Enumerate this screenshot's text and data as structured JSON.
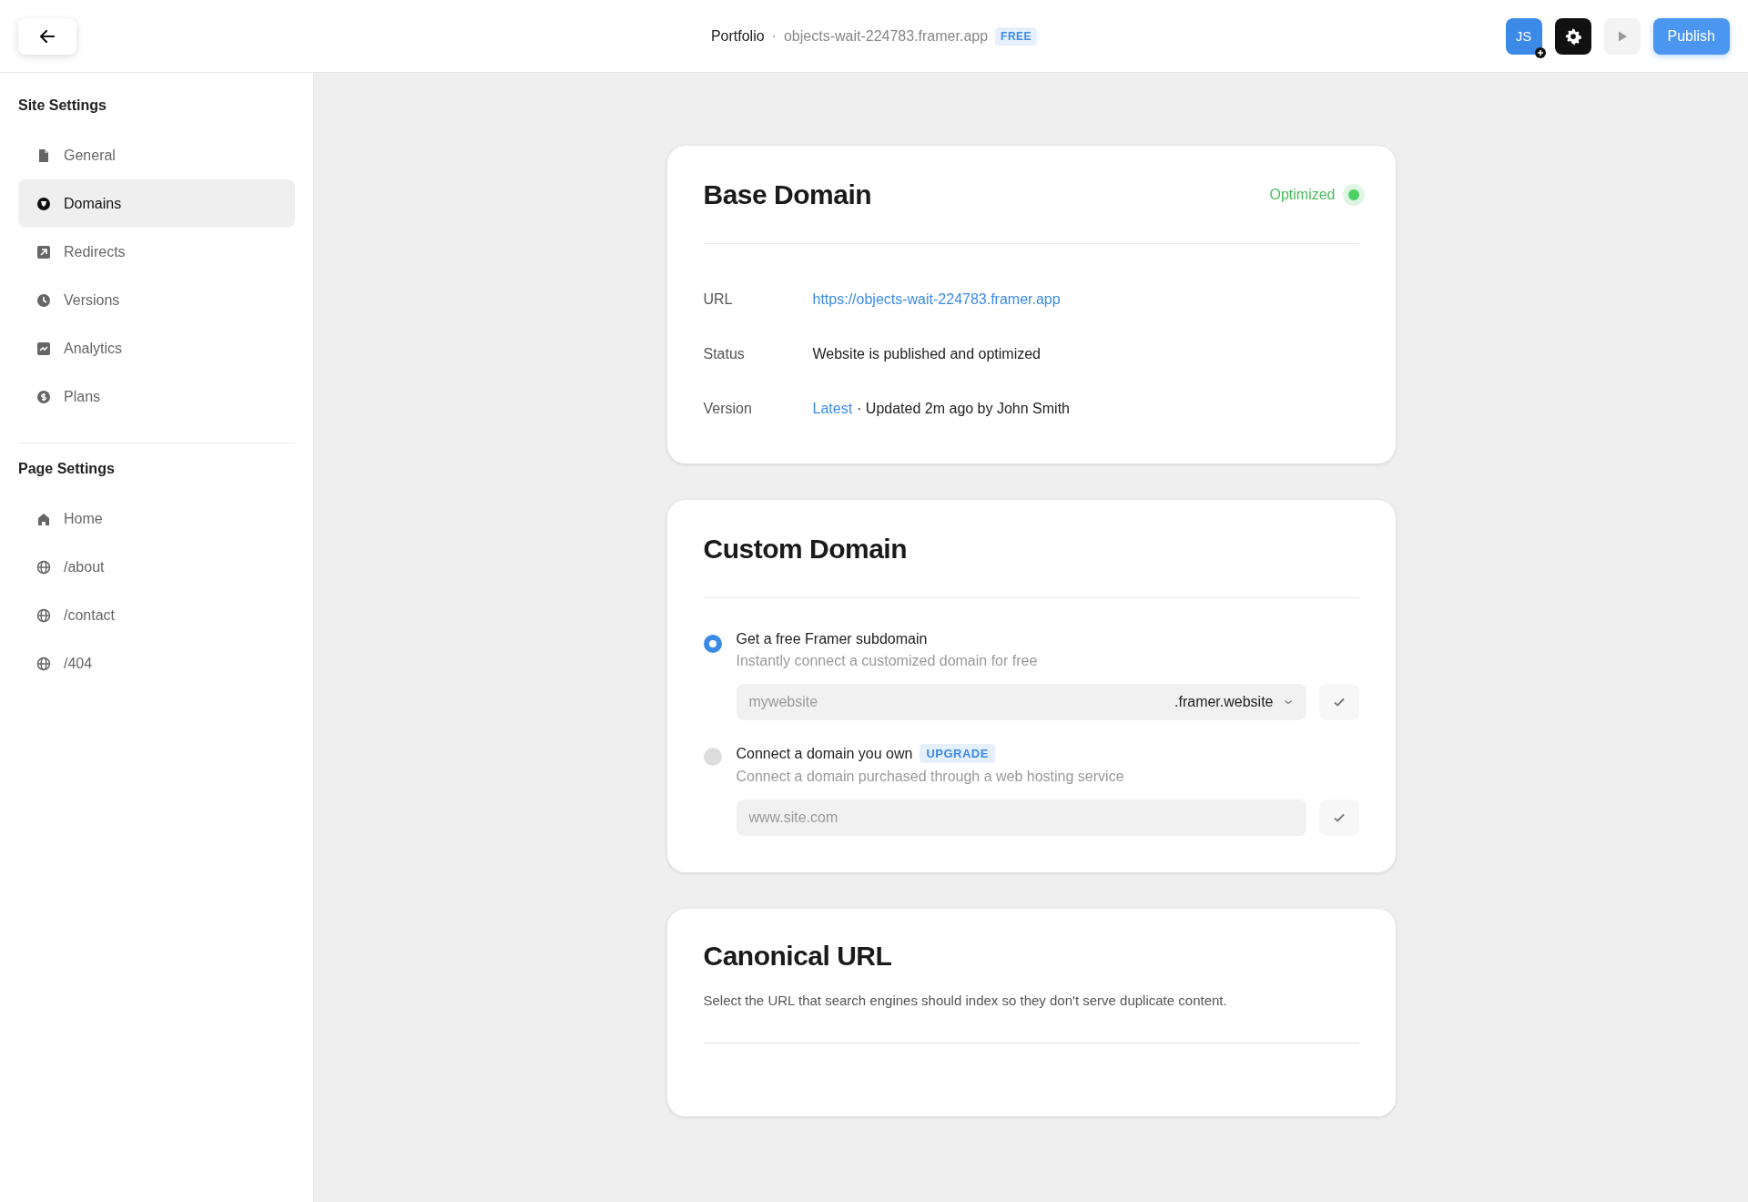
{
  "topbar": {
    "project": "Portfolio",
    "separator": "·",
    "domain": "objects-wait-224783.framer.app",
    "plan": "FREE",
    "avatar": "JS",
    "publish": "Publish"
  },
  "sidebar": [
    {
      "title": "Site Settings",
      "items": [
        {
          "label": "General",
          "kind": "file",
          "selected": false
        },
        {
          "label": "Domains",
          "kind": "shield",
          "selected": true
        },
        {
          "label": "Redirects",
          "kind": "redirect",
          "selected": false
        },
        {
          "label": "Versions",
          "kind": "clock",
          "selected": false
        },
        {
          "label": "Analytics",
          "kind": "chart",
          "selected": false
        },
        {
          "label": "Plans",
          "kind": "dollar",
          "selected": false
        }
      ]
    },
    {
      "title": "Page Settings",
      "items": [
        {
          "label": "Home",
          "kind": "home",
          "selected": false
        },
        {
          "label": "/about",
          "kind": "page",
          "selected": false
        },
        {
          "label": "/contact",
          "kind": "page",
          "selected": false
        },
        {
          "label": "/404",
          "kind": "page",
          "selected": false
        }
      ]
    }
  ],
  "base_domain": {
    "title": "Base Domain",
    "status": "Optimized",
    "rows": [
      {
        "label": "URL",
        "link": "https://objects-wait-224783.framer.app"
      },
      {
        "label": "Status",
        "text": "Website is published and optimized"
      },
      {
        "label": "Version",
        "link": "Latest",
        "text": "· Updated 2m ago by John Smith"
      }
    ]
  },
  "custom_domain": {
    "title": "Custom Domain",
    "options": [
      {
        "title": "Get a free Framer subdomain",
        "description": "Instantly connect a customized domain for free",
        "selected": true,
        "placeholder": "mywebsite",
        "suffix": ".framer.website"
      },
      {
        "title": "Connect a domain you own",
        "badge": "UPGRADE",
        "description": "Connect a domain purchased through a web hosting service",
        "selected": false,
        "placeholder": "www.site.com"
      }
    ]
  },
  "canonical": {
    "title": "Canonical URL",
    "description": "Select the URL that search engines should index so they don't serve duplicate content."
  }
}
